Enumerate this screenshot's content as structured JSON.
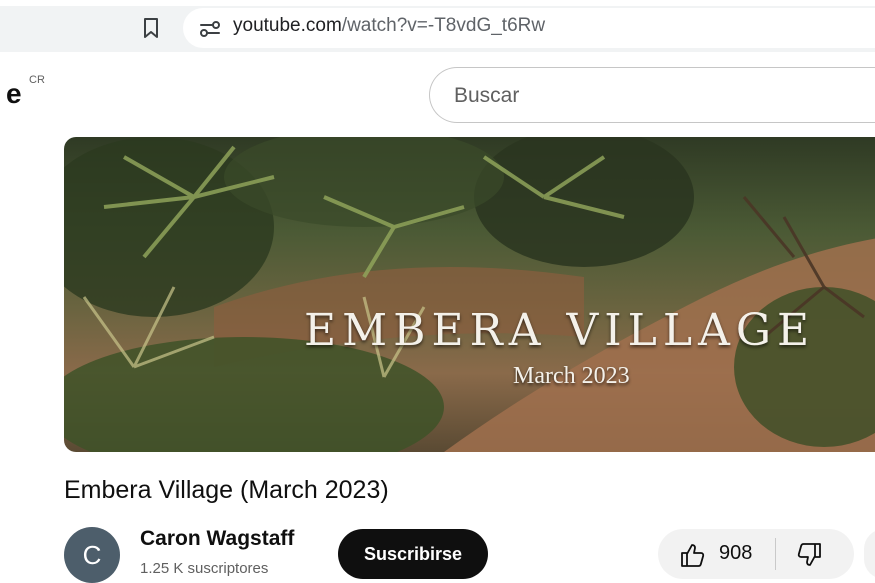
{
  "browser": {
    "url_domain": "youtube.com",
    "url_path": "/watch?v=-T8vdG_t6Rw"
  },
  "header": {
    "logo_fragment": "e",
    "country_code": "CR",
    "search_placeholder": "Buscar"
  },
  "video": {
    "overlay_title": "EMBERA VILLAGE",
    "overlay_date": "March 2023",
    "title": "Embera Village (March 2023)"
  },
  "channel": {
    "avatar_letter": "C",
    "name": "Caron Wagstaff",
    "subscribers": "1.25 K suscriptores",
    "subscribe_label": "Suscribirse"
  },
  "actions": {
    "like_count": "908"
  },
  "colors": {
    "subscribe_bg": "#0f0f0f",
    "avatar_bg": "#4d5e6b",
    "pill_bg": "#f2f2f2"
  }
}
